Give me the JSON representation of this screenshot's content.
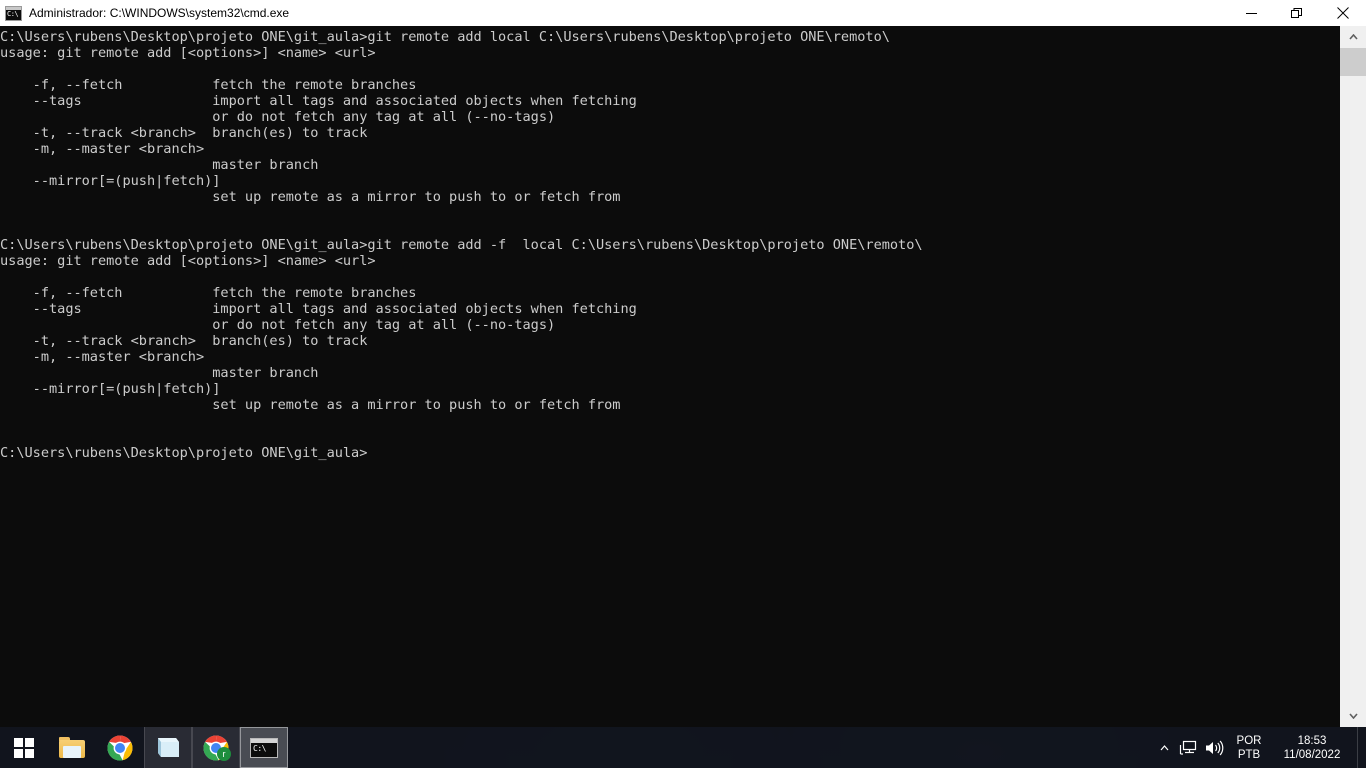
{
  "window": {
    "title": "Administrador: C:\\WINDOWS\\system32\\cmd.exe",
    "icon_name": "cmd-icon",
    "icon_glyph": "C:\\",
    "controls": {
      "minimize_label": "Minimize",
      "restore_label": "Restore",
      "close_label": "Close"
    }
  },
  "console": {
    "foreground_color": "#cccccc",
    "background_color": "#0c0c0c",
    "lines": [
      "C:\\Users\\rubens\\Desktop\\projeto ONE\\git_aula>git remote add local C:\\Users\\rubens\\Desktop\\projeto ONE\\remoto\\",
      "usage: git remote add [<options>] <name> <url>",
      "",
      "    -f, --fetch           fetch the remote branches",
      "    --tags                import all tags and associated objects when fetching",
      "                          or do not fetch any tag at all (--no-tags)",
      "    -t, --track <branch>  branch(es) to track",
      "    -m, --master <branch>",
      "                          master branch",
      "    --mirror[=(push|fetch)]",
      "                          set up remote as a mirror to push to or fetch from",
      "",
      "",
      "C:\\Users\\rubens\\Desktop\\projeto ONE\\git_aula>git remote add -f  local C:\\Users\\rubens\\Desktop\\projeto ONE\\remoto\\",
      "usage: git remote add [<options>] <name> <url>",
      "",
      "    -f, --fetch           fetch the remote branches",
      "    --tags                import all tags and associated objects when fetching",
      "                          or do not fetch any tag at all (--no-tags)",
      "    -t, --track <branch>  branch(es) to track",
      "    -m, --master <branch>",
      "                          master branch",
      "    --mirror[=(push|fetch)]",
      "                          set up remote as a mirror to push to or fetch from",
      "",
      "",
      "C:\\Users\\rubens\\Desktop\\projeto ONE\\git_aula>"
    ]
  },
  "scrollbar": {
    "up_arrow_name": "scroll-up-arrow",
    "down_arrow_name": "scroll-down-arrow",
    "thumb_name": "scrollbar-thumb"
  },
  "taskbar": {
    "start_label": "Start",
    "buttons": [
      {
        "name": "taskbar-file-explorer",
        "icon": "folder-icon",
        "state": "pinned"
      },
      {
        "name": "taskbar-chrome",
        "icon": "chrome-icon",
        "state": "pinned"
      },
      {
        "name": "taskbar-notepad",
        "icon": "notepad-icon",
        "state": "open"
      },
      {
        "name": "taskbar-chrome-profile",
        "icon": "chrome-icon",
        "state": "open",
        "badge": "r"
      },
      {
        "name": "taskbar-cmd",
        "icon": "cmd-icon",
        "state": "focused"
      }
    ],
    "tray": {
      "expand_label": "Show hidden icons",
      "network_label": "Network",
      "volume_label": "Volume",
      "language_top": "POR",
      "language_bottom": "PTB",
      "clock_time": "18:53",
      "clock_date": "11/08/2022"
    }
  }
}
